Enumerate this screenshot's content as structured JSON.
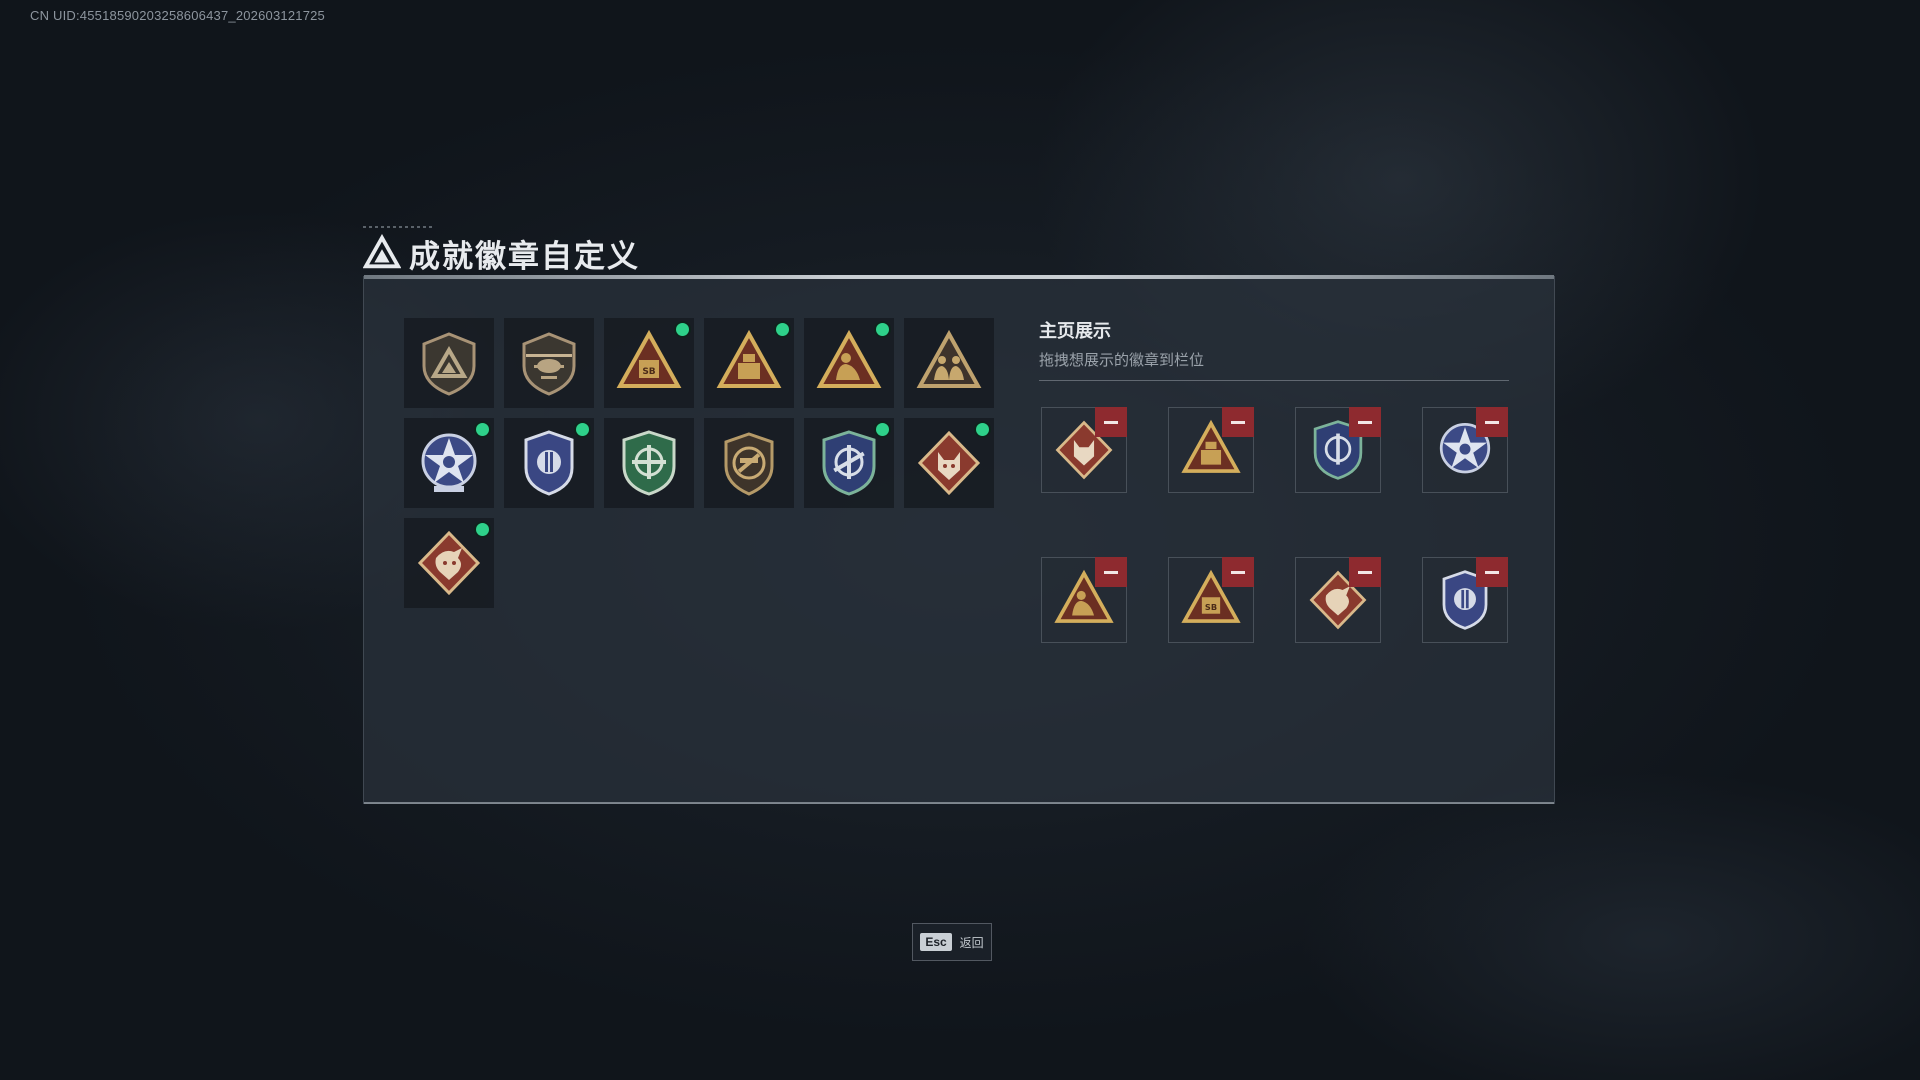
{
  "watermark": {
    "uid_text": "CN UID:4551859020325860643​7_202603121725"
  },
  "header": {
    "title": "成就徽章自定义",
    "logo_icon": "triangle-logo-icon"
  },
  "colors": {
    "new_indicator": "#2ed18a",
    "remove_button": "#8e2a2f",
    "gold": "#c9a050",
    "blue": "#4b5fa3",
    "green": "#2f6b4a",
    "red": "#8a3a2e"
  },
  "badge_collection": [
    {
      "icon": "shield-triangle-badge-icon",
      "new": false
    },
    {
      "icon": "helicopter-badge-icon",
      "new": false
    },
    {
      "icon": "triangle-sb-badge-icon",
      "new": true
    },
    {
      "icon": "triangle-robot-badge-icon",
      "new": true
    },
    {
      "icon": "triangle-soldier-badge-icon",
      "new": true
    },
    {
      "icon": "triangle-squad-badge-icon",
      "new": false
    },
    {
      "icon": "star-emblem-badge-icon",
      "new": true
    },
    {
      "icon": "police-shield-badge-icon",
      "new": true
    },
    {
      "icon": "green-crosshair-badge-icon",
      "new": false
    },
    {
      "icon": "no-gun-shield-badge-icon",
      "new": false
    },
    {
      "icon": "blue-crosshair-badge-icon",
      "new": true
    },
    {
      "icon": "wolf-diamond-badge-icon",
      "new": true
    },
    {
      "icon": "dragon-diamond-badge-icon",
      "new": true
    }
  ],
  "showcase": {
    "title": "主页展示",
    "subtitle": "拖拽想展示的徽章到栏位",
    "slots": [
      {
        "icon": "wolf-diamond-badge-icon"
      },
      {
        "icon": "triangle-robot-badge-icon"
      },
      {
        "icon": "blue-crosshair-badge-icon"
      },
      {
        "icon": "star-emblem-badge-icon"
      },
      {
        "icon": "triangle-soldier-badge-icon"
      },
      {
        "icon": "triangle-sb-badge-icon"
      },
      {
        "icon": "dragon-diamond-badge-icon"
      },
      {
        "icon": "police-shield-badge-icon"
      }
    ]
  },
  "footer": {
    "key": "Esc",
    "label": "返回"
  }
}
